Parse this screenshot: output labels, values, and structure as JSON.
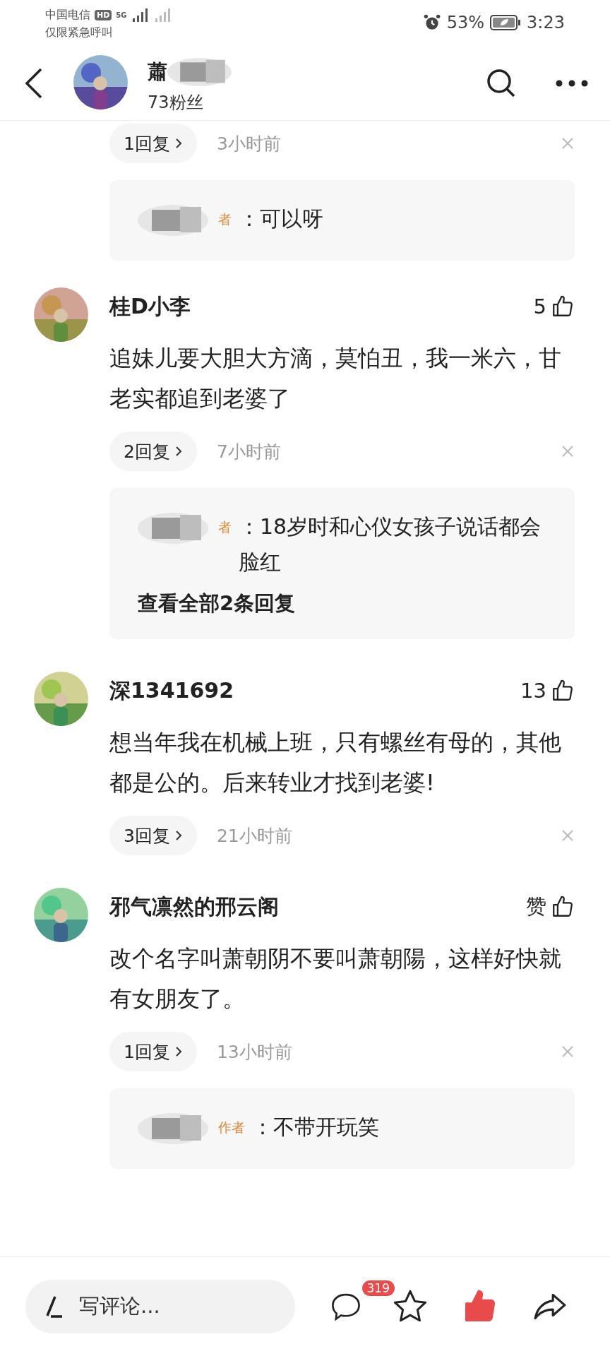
{
  "status_bar": {
    "carrier": "中国电信",
    "carrier_badge": "HD",
    "network": "5G",
    "emergency": "仅限紧急呼叫",
    "battery": "53%",
    "time": "3:23"
  },
  "header": {
    "title": "蕭",
    "followers": "73粉丝"
  },
  "leading_thread": {
    "reply_chip": "1回复",
    "time": "3小时前",
    "replies": [
      {
        "badge": "者",
        "text": "：可以呀"
      }
    ]
  },
  "comments": [
    {
      "name": "桂D小李",
      "likes": "5",
      "text": "追妹儿要大胆大方滴，莫怕丑，我一米六，甘老实都追到老婆了",
      "reply_chip": "2回复",
      "time": "7小时前",
      "replies": [
        {
          "badge": "者",
          "text": "：18岁时和心仪女孩子说话都会脸红"
        }
      ],
      "more": "查看全部2条回复"
    },
    {
      "name": "深1341692",
      "likes": "13",
      "text": "想当年我在机械上班，只有螺丝有母的，其他都是公的。后来转业才找到老婆!",
      "reply_chip": "3回复",
      "time": "21小时前"
    },
    {
      "name": "邪气凛然的邢云阁",
      "likes": "赞",
      "text": "改个名字叫萧朝阴不要叫萧朝陽，这样好快就有女朋友了。",
      "reply_chip": "1回复",
      "time": "13小时前",
      "replies": [
        {
          "badge": "作者",
          "text": "：不带开玩笑"
        }
      ]
    }
  ],
  "bottom_bar": {
    "placeholder": "写评论...",
    "comment_count": "319",
    "liked": true
  }
}
